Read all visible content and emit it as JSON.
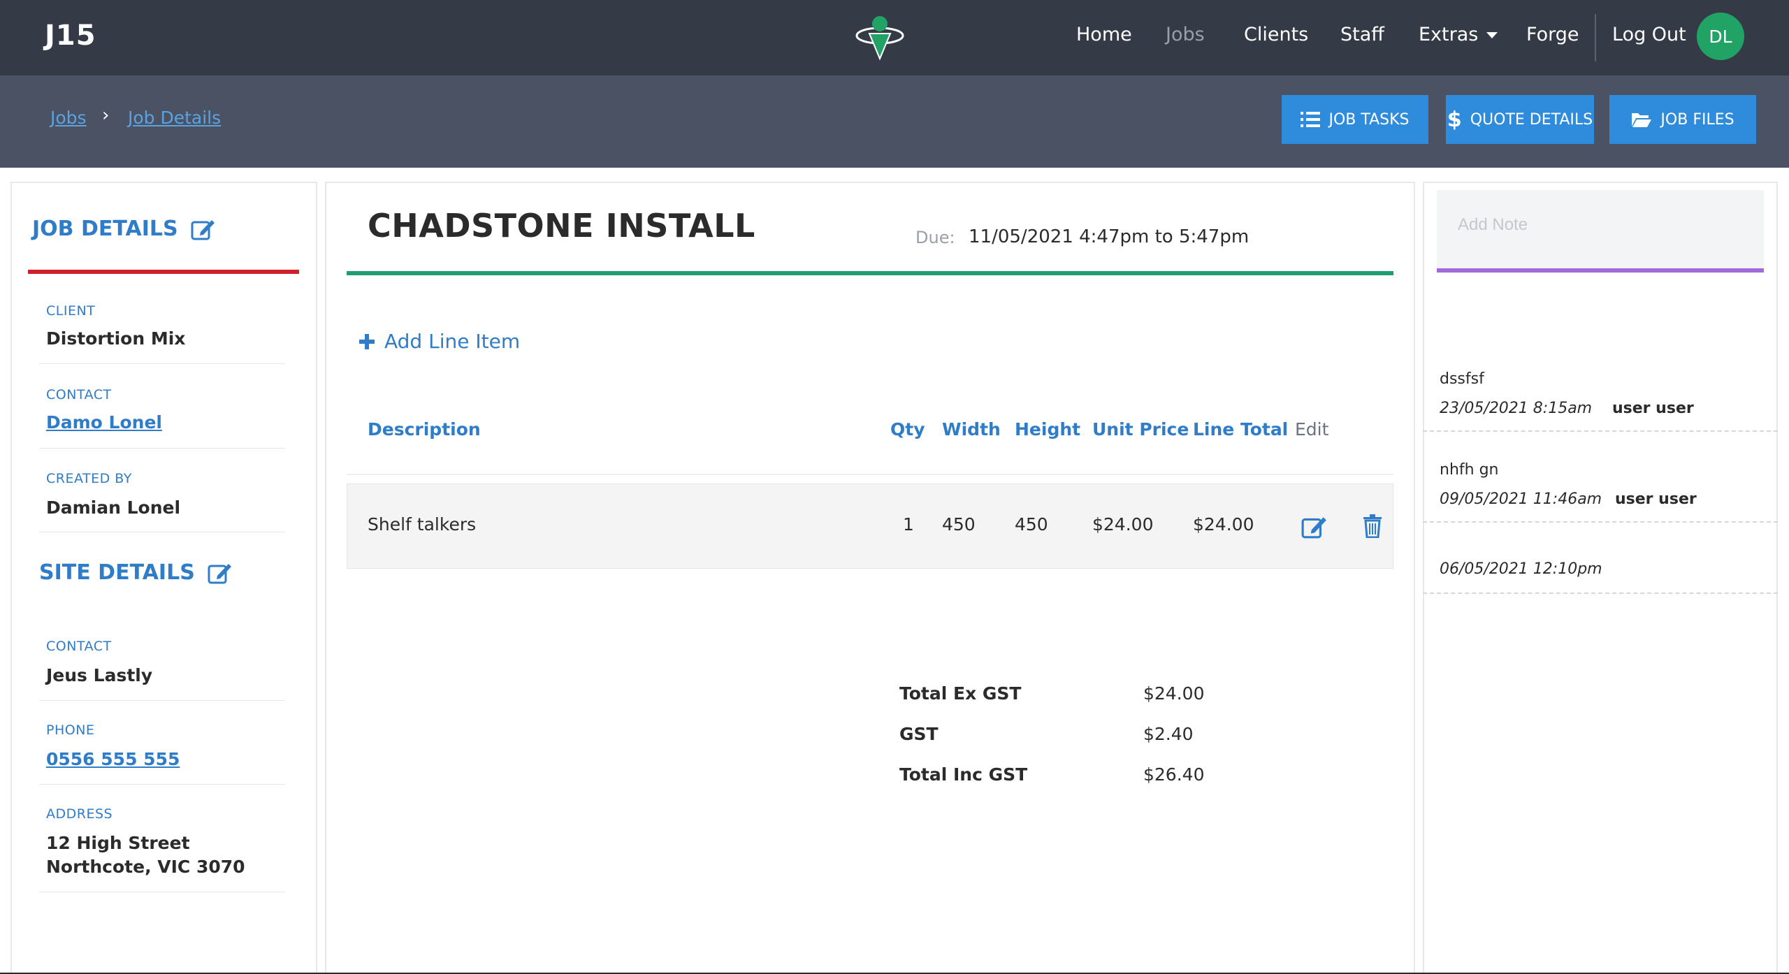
{
  "app": {
    "brand": "J15"
  },
  "nav": {
    "home": "Home",
    "jobs": "Jobs",
    "clients": "Clients",
    "staff": "Staff",
    "extras": "Extras",
    "forge": "Forge",
    "logout": "Log Out",
    "avatar_initials": "DL"
  },
  "breadcrumb": {
    "jobs": "Jobs",
    "separator": "›",
    "job_details": "Job Details"
  },
  "actions": {
    "job_tasks": "JOB TASKS",
    "quote_details": "QUOTE DETAILS",
    "job_files": "JOB FILES"
  },
  "job_details": {
    "title": "JOB DETAILS",
    "client_label": "CLIENT",
    "client": "Distortion Mix",
    "contact_label": "CONTACT",
    "contact": "Damo Lonel",
    "created_by_label": "CREATED BY",
    "created_by": "Damian Lonel"
  },
  "site_details": {
    "title": "SITE DETAILS",
    "contact_label": "CONTACT",
    "contact": "Jeus Lastly",
    "phone_label": "PHONE",
    "phone": "0556 555 555",
    "address_label": "ADDRESS",
    "address_line1": "12 High Street",
    "address_line2": "Northcote, VIC 3070"
  },
  "job": {
    "title": "CHADSTONE INSTALL",
    "due_label": "Due:",
    "due_value": "11/05/2021 4:47pm to 5:47pm"
  },
  "line_items": {
    "add_label": "Add Line Item",
    "headers": {
      "description": "Description",
      "qty": "Qty",
      "width": "Width",
      "height": "Height",
      "unit_price": "Unit Price",
      "line_total": "Line Total",
      "edit": "Edit"
    },
    "rows": [
      {
        "description": "Shelf talkers",
        "qty": "1",
        "width": "450",
        "height": "450",
        "unit_price": "$24.00",
        "line_total": "$24.00"
      }
    ]
  },
  "totals": {
    "ex_gst_label": "Total Ex GST",
    "ex_gst": "$24.00",
    "gst_label": "GST",
    "gst": "$2.40",
    "inc_gst_label": "Total Inc GST",
    "inc_gst": "$26.40"
  },
  "notes": {
    "placeholder": "Add Note",
    "items": [
      {
        "text": "dssfsf",
        "date": "23/05/2021 8:15am",
        "user": "user user"
      },
      {
        "text": "nhfh gn",
        "date": "09/05/2021 11:46am",
        "user": "user user"
      },
      {
        "text": "",
        "date": "06/05/2021 12:10pm",
        "user": ""
      }
    ]
  },
  "colors": {
    "nav_bg": "#343a46",
    "subbar_bg": "#4b5263",
    "accent_blue": "#2f7cc8",
    "button_blue": "#2f8bdc",
    "job_details_rule": "#d0202a",
    "title_rule": "#1e9e72",
    "note_rule": "#a26ad8",
    "avatar_bg": "#21a366"
  }
}
